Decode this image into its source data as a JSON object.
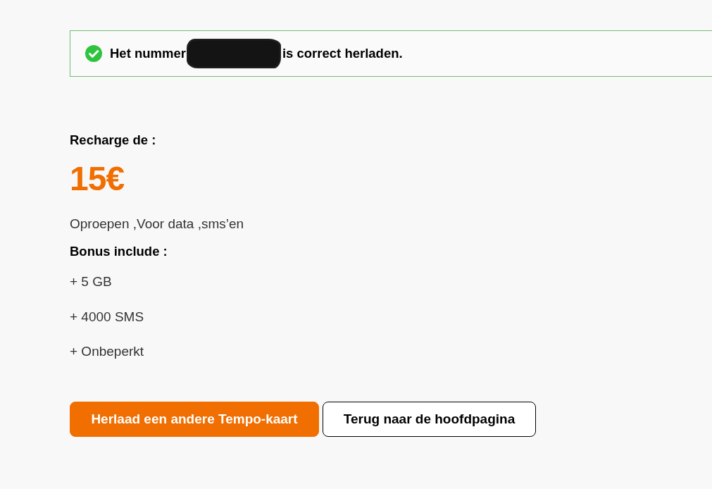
{
  "notice": {
    "text_start": "Het nummer",
    "redacted": true,
    "text_end": "is correct herladen."
  },
  "recharge": {
    "label": "Recharge de :",
    "amount": "15€",
    "description": "Oproepen ,Voor data ,sms’en"
  },
  "bonus": {
    "title": "Bonus include :",
    "items": [
      "+ 5 GB",
      "+ 4000 SMS",
      "+ Onbeperkt"
    ]
  },
  "buttons": [
    {
      "label": "Herlaad een andere Tempo-kaart",
      "kind": "primary"
    },
    {
      "label": "Terug naar de hoofdpagina",
      "kind": "secondary"
    }
  ]
}
